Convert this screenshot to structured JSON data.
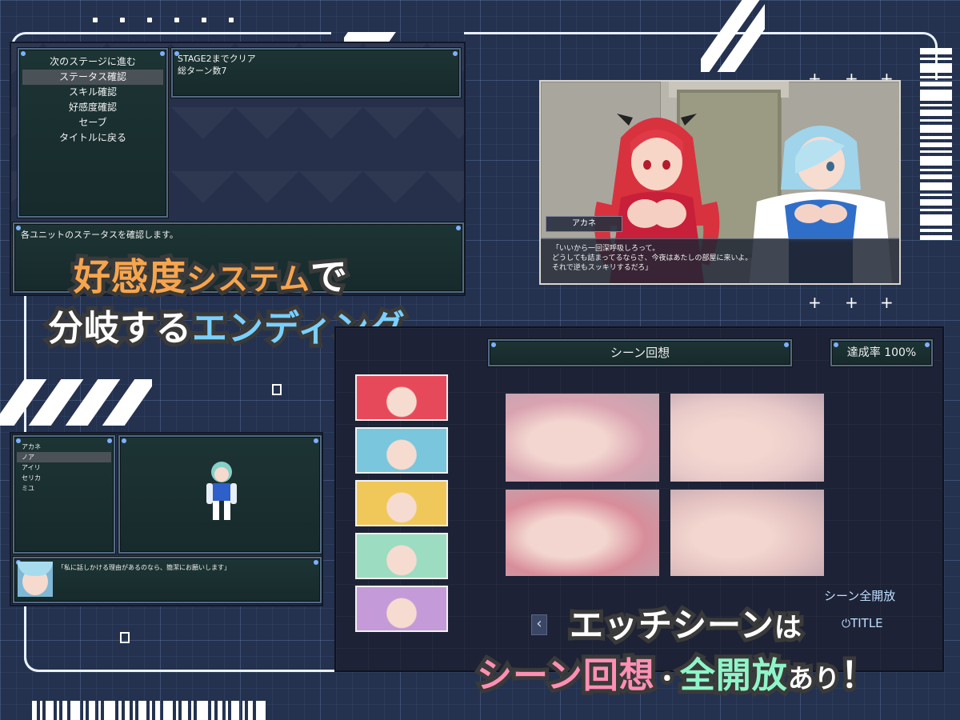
{
  "status_screen": {
    "menu": [
      {
        "label": "次のステージに進む",
        "selected": false
      },
      {
        "label": "ステータス確認",
        "selected": true
      },
      {
        "label": "スキル確認",
        "selected": false
      },
      {
        "label": "好感度確認",
        "selected": false
      },
      {
        "label": "セーブ",
        "selected": false
      },
      {
        "label": "タイトルに戻る",
        "selected": false
      }
    ],
    "info_lines": [
      "STAGE2までクリア",
      "総ターン数7"
    ],
    "help_text": "各ユニットのステータスを確認します。"
  },
  "dialogue_scene": {
    "speaker": "アカネ",
    "lines": [
      "「いいから一回深呼吸しろって。",
      "どうしても詰まってるならさ、今夜はあたしの部屋に来いよ。",
      "それで逆もスッキリするだろ」"
    ]
  },
  "headline_top": {
    "line1": [
      {
        "text": "好感度",
        "color": "orange"
      },
      {
        "text": "システム",
        "color": "orange"
      },
      {
        "text": "で",
        "color": "white"
      }
    ],
    "line2": [
      {
        "text": "分岐する",
        "color": "white"
      },
      {
        "text": "エンディング",
        "color": "blue"
      }
    ]
  },
  "scene_recollection": {
    "title": "シーン回想",
    "completion": "達成率 100%",
    "unlock_all": "シーン全開放",
    "title_button": "TITLE",
    "prev_arrow": "‹",
    "character_colors": [
      "#e64a5a",
      "#79c6dd",
      "#f0c85a",
      "#9cdcc0",
      "#c49ad8"
    ],
    "cg_tones": [
      "#d9a3b1",
      "#e8c9c9",
      "#d88d9a",
      "#e3c1c0"
    ]
  },
  "unit_talk": {
    "units": [
      {
        "name": "アカネ",
        "selected": false
      },
      {
        "name": "ノア",
        "selected": true
      },
      {
        "name": "アイリ",
        "selected": false
      },
      {
        "name": "セリカ",
        "selected": false
      },
      {
        "name": "ミユ",
        "selected": false
      }
    ],
    "message": "「私に話しかける理由があるのなら、簡潔にお願いします」"
  },
  "headline_bottom": {
    "line1": [
      {
        "text": "エッチシーン",
        "color": "white"
      },
      {
        "text": "は",
        "color": "white"
      }
    ],
    "line2": [
      {
        "text": "シーン",
        "color": "pink"
      },
      {
        "text": "回想",
        "color": "pink"
      },
      {
        "text": "・",
        "color": "white"
      },
      {
        "text": "全開放",
        "color": "mint"
      },
      {
        "text": "あり",
        "color": "white"
      },
      {
        "text": "！",
        "color": "white"
      }
    ]
  }
}
